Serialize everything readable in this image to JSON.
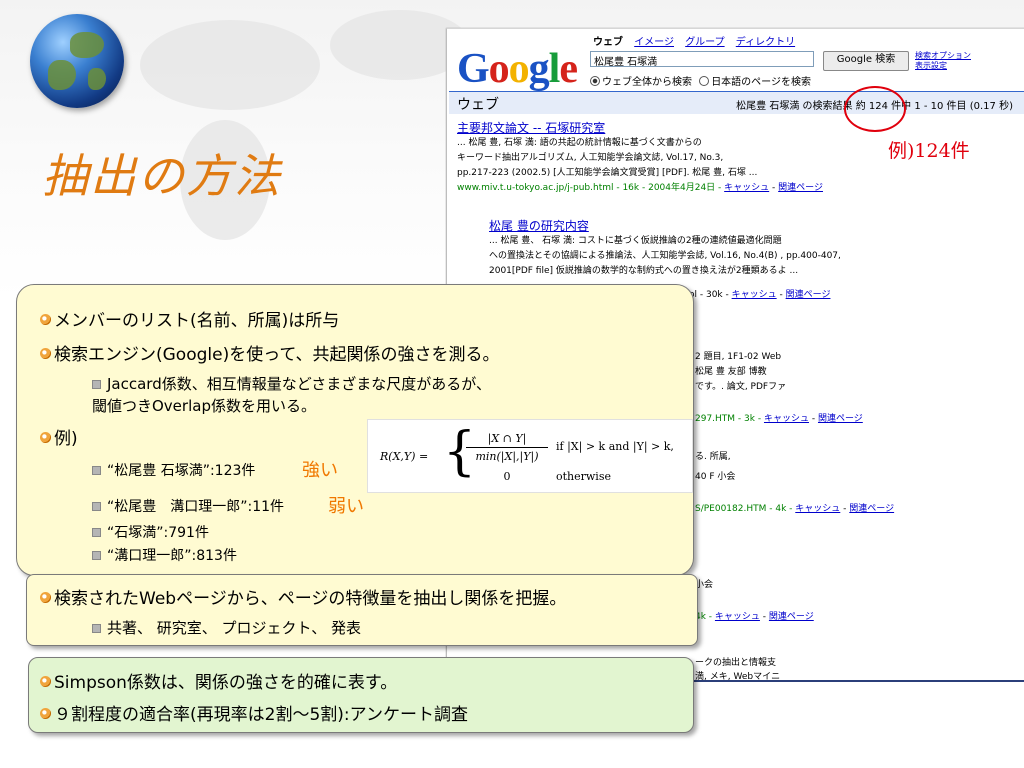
{
  "slide": {
    "title": "抽出の方法",
    "colors": {
      "title": "#e07b12",
      "accent_red": "#e0000d",
      "accent_orange": "#f07800",
      "box_yellow": "#fffbd2",
      "box_green": "#e2f5d0"
    }
  },
  "google": {
    "logo": "Google",
    "tabs": [
      "ウェブ",
      "イメージ",
      "グループ",
      "ディレクトリ"
    ],
    "query": "松尾豊 石塚満",
    "search_button": "Google 検索",
    "advanced_link_1": "検索オプション",
    "advanced_link_2": "表示設定",
    "radio_all": "ウェブ全体から検索",
    "radio_ja": "日本語のページを検索",
    "bar_label": "ウェブ",
    "stats": "松尾豊 石塚満 の検索結果 約 124 件中 1 - 10 件目 (0.17 秒)",
    "results": [
      {
        "title": "主要邦文論文 -- 石塚研究室",
        "snippet1": "... 松尾 豊, 石塚 満: 語の共起の統計情報に基づく文書からの",
        "snippet2": "キーワード抽出アルゴリズム, 人工知能学会論文誌, Vol.17, No.3,",
        "snippet3": "pp.217-223 (2002.5) [人工知能学会論文賞受賞] [PDF]. 松尾 豊, 石塚 ...",
        "url": "www.miv.t.u-tokyo.ac.jp/j-pub.html - 16k - 2004年4月24日 -",
        "cache": "キャッシュ",
        "related": "関連ページ"
      },
      {
        "title": "松尾 豊の研究内容",
        "snippet1": "... 松尾 豊、 石塚 満: コストに基づく仮説推論の2種の連続値最適化問題",
        "snippet2": "への置換法とその協調による推論法、人工知能学会誌, Vol.16, No.4(B) , pp.400-407,",
        "snippet3": "2001[PDF file] 仮説推論の数学的な制約式への置き換え法が2種類あるよ ...",
        "url_tail": "ol - 30k -",
        "cache": "キャッシュ",
        "related": "関連ページ"
      }
    ],
    "fragments": [
      "2 題目, 1F1-02 Web",
      "松尾 豊 友部 博教",
      "です。. 論文, PDFファ",
      "297.HTM - 3k -",
      "る. 所属,",
      "40 F 小会",
      "S/PE00182.HTM - 4k -",
      "小会",
      "4k -",
      "ークの抽出と情報支",
      "満, メキ, Webマイニ"
    ],
    "cache": "キャッシュ",
    "related": "関連ページ"
  },
  "annotation": {
    "example": "例)124件"
  },
  "box1": {
    "bullet1": "メンバーのリスト(名前、所属)は所与",
    "bullet2": "検索エンジン(Google)を使って、共起関係の強さを測る。",
    "sub1_line1": "Jaccard係数、相互情報量などさまざまな尺度があるが、",
    "sub1_line2": "閾値つきOverlap係数を用いる。",
    "bullet3": "例)",
    "ex1": "“松尾豊 石塚満”:123件",
    "ex1_tag": "強い",
    "ex2": "“松尾豊　溝口理一郎”:11件",
    "ex2_tag": "弱い",
    "ex3": "“石塚満”:791件",
    "ex4": "“溝口理一郎”:813件"
  },
  "formula": {
    "lhs": "R(X,Y) =",
    "num": "|X ∩ Y|",
    "den": "min(|X|,|Y|)",
    "cond1": "if |X| > k and |Y| > k,",
    "zero": "0",
    "cond2": "otherwise"
  },
  "box2": {
    "bullet": "検索されたWebページから、ページの特徴量を抽出し関係を把握。",
    "sub": "共著、 研究室、 プロジェクト、 発表"
  },
  "box3": {
    "line1": "Simpson係数は、関係の強さを的確に表す。",
    "line2": "９割程度の適合率(再現率は2割～5割):アンケート調査"
  }
}
